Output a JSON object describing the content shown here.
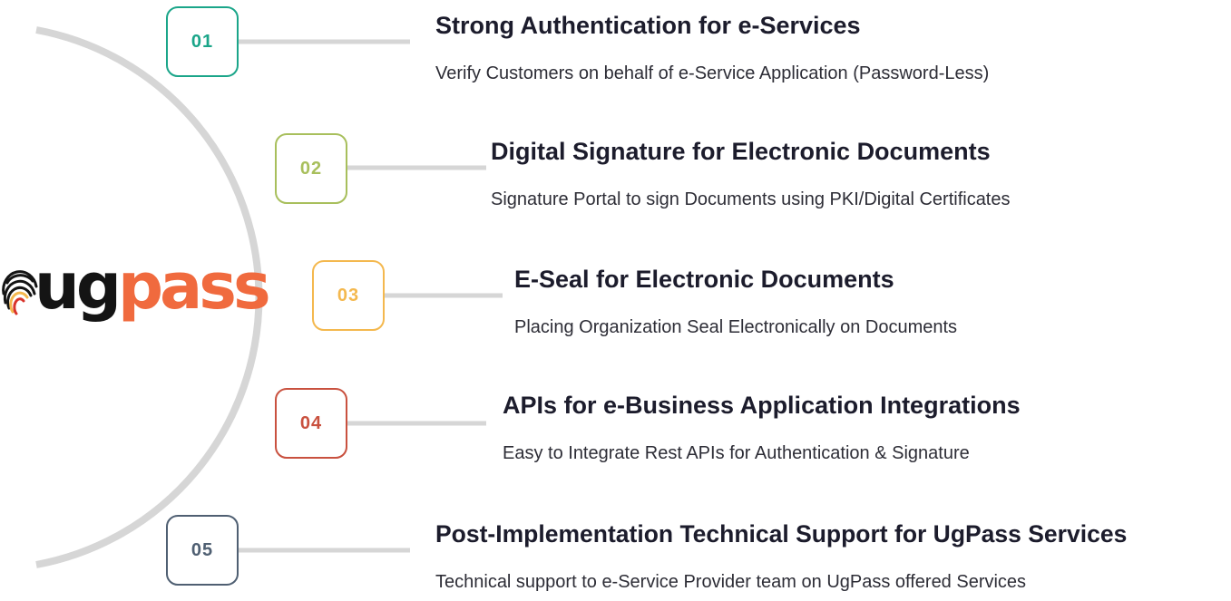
{
  "logo": {
    "brand_part1": "ug",
    "brand_part2": "pass",
    "colors": {
      "dark": "#141414",
      "accent": "#f06a3e"
    }
  },
  "arc_color": "#d6d6d6",
  "items": [
    {
      "number": "01",
      "color": "#1aa589",
      "title": "Strong Authentication for e-Services",
      "description": "Verify Customers on behalf of e-Service Application (Password-Less)"
    },
    {
      "number": "02",
      "color": "#a8bf5c",
      "title": "Digital Signature for Electronic Documents",
      "description": "Signature Portal to sign Documents using PKI/Digital Certificates"
    },
    {
      "number": "03",
      "color": "#f4b84e",
      "title": "E-Seal for Electronic Documents",
      "description": "Placing Organization Seal Electronically on Documents"
    },
    {
      "number": "04",
      "color": "#c9513f",
      "title": "APIs for e-Business Application Integrations",
      "description": "Easy to Integrate Rest APIs for Authentication & Signature"
    },
    {
      "number": "05",
      "color": "#4f5f72",
      "title": "Post-Implementation Technical Support for UgPass Services",
      "description": "Technical support to e-Service Provider team on UgPass offered Services"
    }
  ]
}
